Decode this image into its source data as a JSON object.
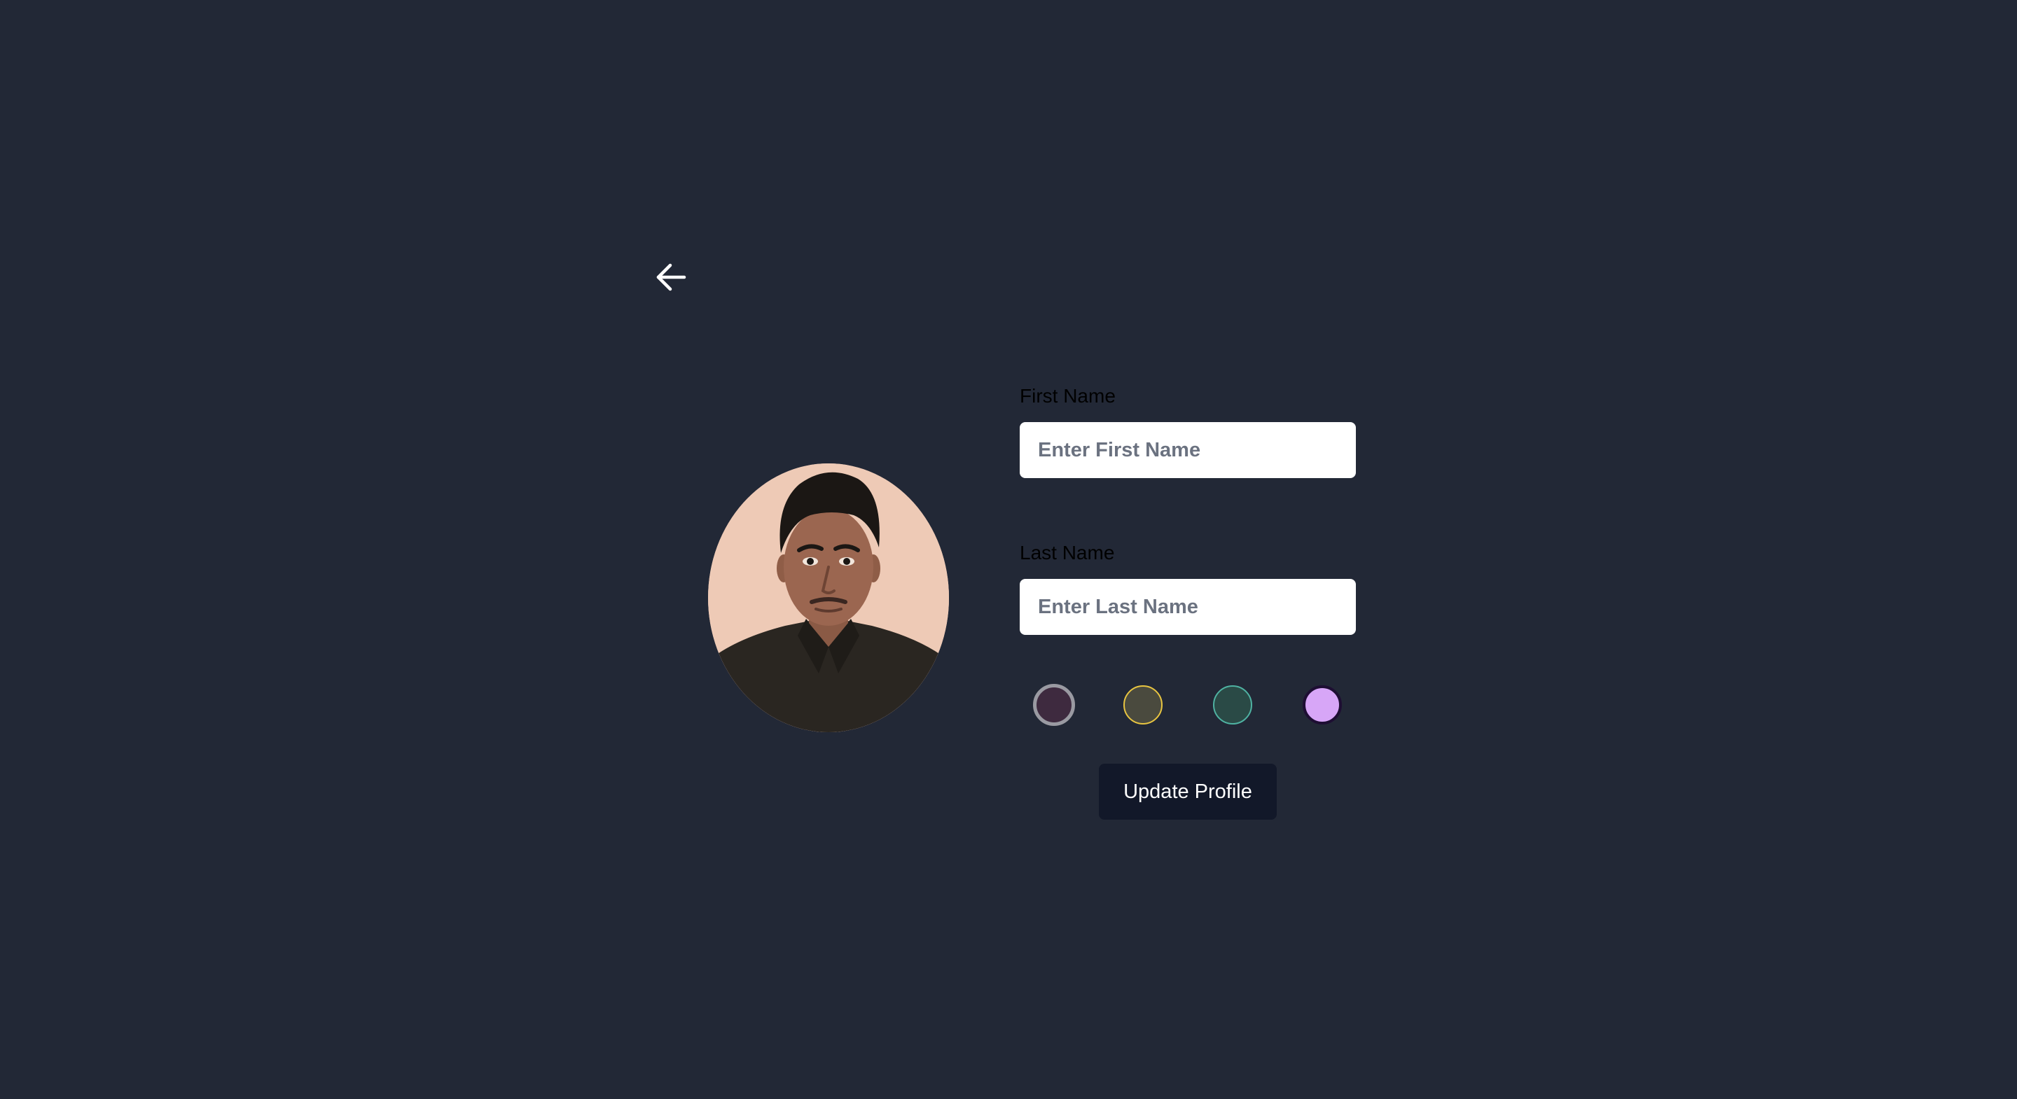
{
  "colors": {
    "background": "#222836",
    "input_background": "#ffffff",
    "placeholder_text": "#6b7280",
    "button_background": "#121829",
    "button_text": "#ffffff",
    "label_text": "#000000"
  },
  "header": {
    "back_icon": "arrow-left-icon"
  },
  "profile": {
    "avatar": "avatar-photo"
  },
  "form": {
    "first_name": {
      "label": "First Name",
      "value": "",
      "placeholder": "Enter First Name"
    },
    "last_name": {
      "label": "Last Name",
      "value": "",
      "placeholder": "Enter Last Name"
    },
    "color_options": [
      {
        "fill": "#3e2a3f",
        "border": "#9a9aa2",
        "selected": true
      },
      {
        "fill": "#4a4a3e",
        "border": "#e8c541",
        "selected": false
      },
      {
        "fill": "#2a4a46",
        "border": "#4fb2a2",
        "selected": false
      },
      {
        "fill": "#d7a6f7",
        "border": "#1e0e33",
        "selected": false
      }
    ],
    "submit_label": "Update Profile"
  }
}
